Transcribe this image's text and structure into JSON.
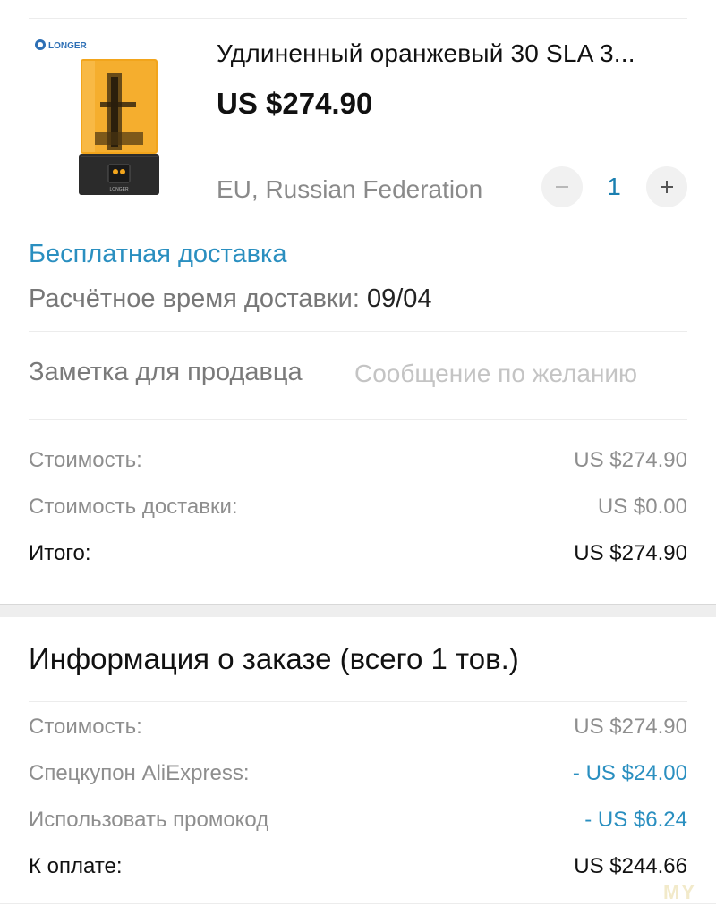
{
  "product": {
    "brand": "LONGER",
    "title": "Удлиненный оранжевый 30 SLA 3...",
    "price": "US $274.90",
    "ship_to": "EU, Russian Federation",
    "quantity": "1",
    "minus_symbol": "−",
    "plus_symbol": "+"
  },
  "shipping": {
    "free_label": "Бесплатная доставка",
    "estimate_label": "Расчётное время доставки:",
    "estimate_date": "09/04"
  },
  "seller_note": {
    "label": "Заметка для продавца",
    "placeholder": "Сообщение по желанию"
  },
  "item_summary": {
    "cost_label": "Стоимость:",
    "cost_value": "US $274.90",
    "shipping_label": "Стоимость доставки:",
    "shipping_value": "US $0.00",
    "total_label": "Итого:",
    "total_value": "US $274.90"
  },
  "order_info": {
    "title": "Информация о заказе (всего 1 тов.)",
    "cost_label": "Стоимость:",
    "cost_value": "US $274.90",
    "coupon_label": "Спецкупон AliExpress:",
    "coupon_value": "- US $24.00",
    "promo_label": "Использовать промокод",
    "promo_value": "- US $6.24",
    "pay_label": "К оплате:",
    "pay_value": "US $244.66"
  },
  "watermark": "MY",
  "colors": {
    "accent": "#2a8fc0",
    "quantity": "#1a7fb0",
    "printer_orange": "#f0a21a",
    "printer_base": "#2b2b2b"
  },
  "icons": {
    "minus": "minus-icon",
    "plus": "plus-icon",
    "brand_logo": "longer-logo-icon"
  }
}
